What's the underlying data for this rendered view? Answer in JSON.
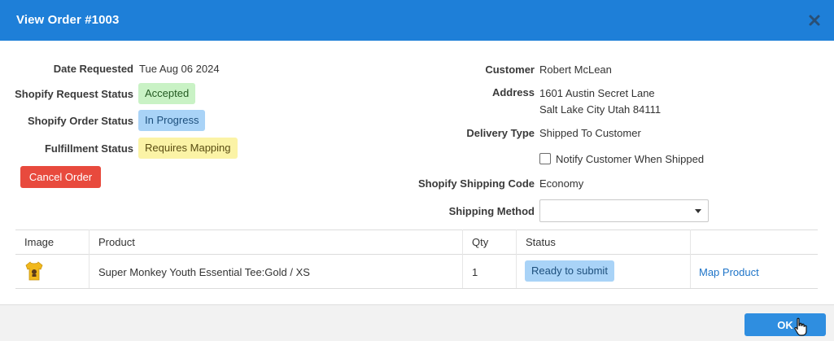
{
  "dialog": {
    "title": "View Order #1003",
    "close_icon": "close-icon"
  },
  "order": {
    "date_requested_label": "Date Requested",
    "date_requested": "Tue Aug 06 2024",
    "shopify_request_status_label": "Shopify Request Status",
    "shopify_request_status": "Accepted",
    "shopify_order_status_label": "Shopify Order Status",
    "shopify_order_status": "In Progress",
    "fulfillment_status_label": "Fulfillment Status",
    "fulfillment_status": "Requires Mapping",
    "cancel_label": "Cancel Order"
  },
  "customer": {
    "customer_label": "Customer",
    "name": "Robert McLean",
    "address_label": "Address",
    "address_line1": "1601 Austin Secret Lane",
    "address_line2": "Salt Lake City Utah 84111",
    "delivery_type_label": "Delivery Type",
    "delivery_type": "Shipped To Customer",
    "notify_label": "Notify Customer When Shipped",
    "notify_checked": false,
    "shipping_code_label": "Shopify Shipping Code",
    "shipping_code": "Economy",
    "shipping_method_label": "Shipping Method",
    "shipping_method": ""
  },
  "table": {
    "headers": [
      "Image",
      "Product",
      "Qty",
      "Status",
      ""
    ],
    "rows": [
      {
        "image_icon": "tshirt-icon",
        "product": "Super Monkey Youth Essential Tee:Gold / XS",
        "qty": "1",
        "status": "Ready to submit",
        "action": "Map Product"
      }
    ]
  },
  "footer": {
    "ok_label": "OK"
  },
  "colors": {
    "header": "#1e7fd8",
    "danger": "#e84a3d",
    "primary": "#2f8ee0",
    "badge_green": "#c9f2c5",
    "badge_blue": "#a9d3f7",
    "badge_yellow": "#fbf3a6",
    "link": "#1e74c8"
  }
}
